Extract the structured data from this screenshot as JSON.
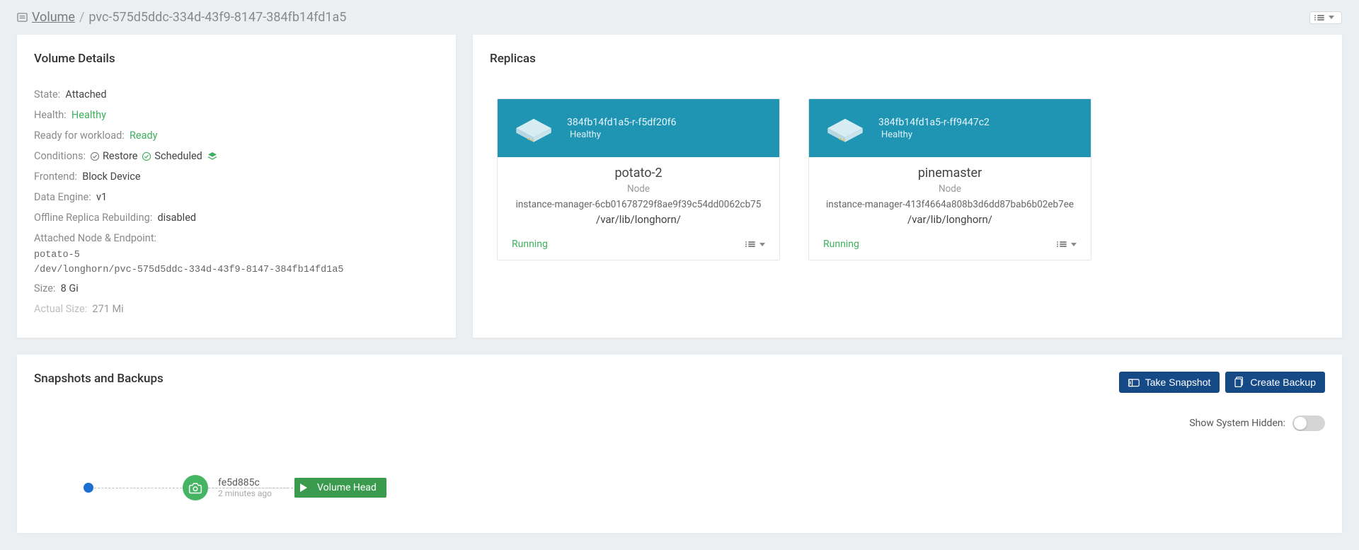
{
  "breadcrumb": {
    "root": "Volume",
    "current": "pvc-575d5ddc-334d-43f9-8147-384fb14fd1a5"
  },
  "details": {
    "heading": "Volume Details",
    "labels": {
      "state": "State:",
      "health": "Health:",
      "ready": "Ready for workload:",
      "conditions": "Conditions:",
      "frontend": "Frontend:",
      "engine": "Data Engine:",
      "rebuild": "Offline Replica Rebuilding:",
      "attached": "Attached Node & Endpoint:",
      "size": "Size:",
      "actual": "Actual Size:"
    },
    "values": {
      "state": "Attached",
      "health": "Healthy",
      "ready": "Ready",
      "cond_restore": "Restore",
      "cond_scheduled": "Scheduled",
      "frontend": "Block Device",
      "engine": "v1",
      "rebuild": "disabled",
      "node": "potato-5",
      "endpoint": "/dev/longhorn/pvc-575d5ddc-334d-43f9-8147-384fb14fd1a5",
      "size": "8 Gi",
      "actual": "271 Mi"
    }
  },
  "replicas": {
    "heading": "Replicas",
    "items": [
      {
        "name": "384fb14fd1a5-r-f5df20f6",
        "health": "Healthy",
        "node": "potato-2",
        "node_label": "Node",
        "im": "instance-manager-6cb01678729f8ae9f39c54dd0062cb75",
        "path": "/var/lib/longhorn/",
        "state": "Running"
      },
      {
        "name": "384fb14fd1a5-r-ff9447c2",
        "health": "Healthy",
        "node": "pinemaster",
        "node_label": "Node",
        "im": "instance-manager-413f4664a808b3d6dd87bab6b02eb7ee",
        "path": "/var/lib/longhorn/",
        "state": "Running"
      }
    ]
  },
  "snapshots": {
    "heading": "Snapshots and Backups",
    "take_snapshot": "Take Snapshot",
    "create_backup": "Create Backup",
    "show_hidden_label": "Show System Hidden:",
    "show_hidden": false,
    "snap_id": "fe5d885c",
    "snap_time": "2 minutes ago",
    "volume_head": "Volume Head"
  },
  "colors": {
    "accent_blue": "#164a87",
    "replica_header": "#1f94b3",
    "healthy_green": "#3eb05e",
    "snapshot_green": "#45b463",
    "timeline_dot": "#1d6fd4"
  }
}
